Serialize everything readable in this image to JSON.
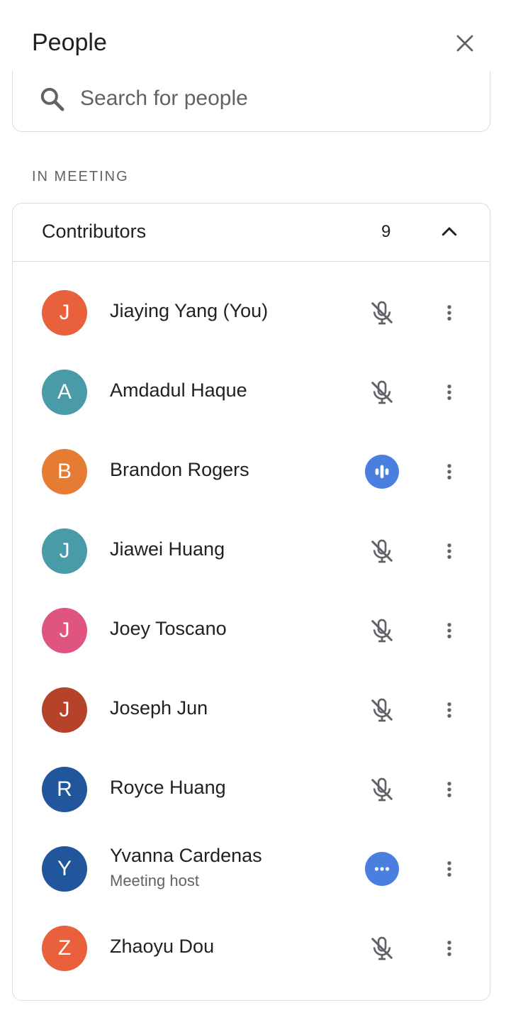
{
  "header": {
    "title": "People",
    "close_icon": "close-icon"
  },
  "search": {
    "placeholder": "Search for people",
    "icon": "search-icon"
  },
  "section": {
    "label": "IN MEETING"
  },
  "group": {
    "title": "Contributors",
    "count": "9",
    "icon": "chevron-up-icon"
  },
  "participants": [
    {
      "initial": "J",
      "name": "Jiaying Yang (You)",
      "subtitle": "",
      "color": "#e8603c",
      "status": "mic-off"
    },
    {
      "initial": "A",
      "name": "Amdadul Haque",
      "subtitle": "",
      "color": "#4a9ba8",
      "status": "mic-off"
    },
    {
      "initial": "B",
      "name": "Brandon Rogers",
      "subtitle": "",
      "color": "#e67c33",
      "status": "speaking"
    },
    {
      "initial": "J",
      "name": "Jiawei Huang",
      "subtitle": "",
      "color": "#4a9ba8",
      "status": "mic-off"
    },
    {
      "initial": "J",
      "name": "Joey Toscano",
      "subtitle": "",
      "color": "#e05480",
      "status": "mic-off"
    },
    {
      "initial": "J",
      "name": "Joseph Jun",
      "subtitle": "",
      "color": "#b5432a",
      "status": "mic-off"
    },
    {
      "initial": "R",
      "name": "Royce Huang",
      "subtitle": "",
      "color": "#22569c",
      "status": "mic-off"
    },
    {
      "initial": "Y",
      "name": "Yvanna Cardenas",
      "subtitle": "Meeting host",
      "color": "#22569c",
      "status": "more-options"
    },
    {
      "initial": "Z",
      "name": "Zhaoyu Dou",
      "subtitle": "",
      "color": "#e8603c",
      "status": "mic-off"
    }
  ],
  "colors": {
    "accent": "#4a7fe0",
    "border": "#dadce0",
    "text": "#202124",
    "muted": "#5f6368"
  }
}
